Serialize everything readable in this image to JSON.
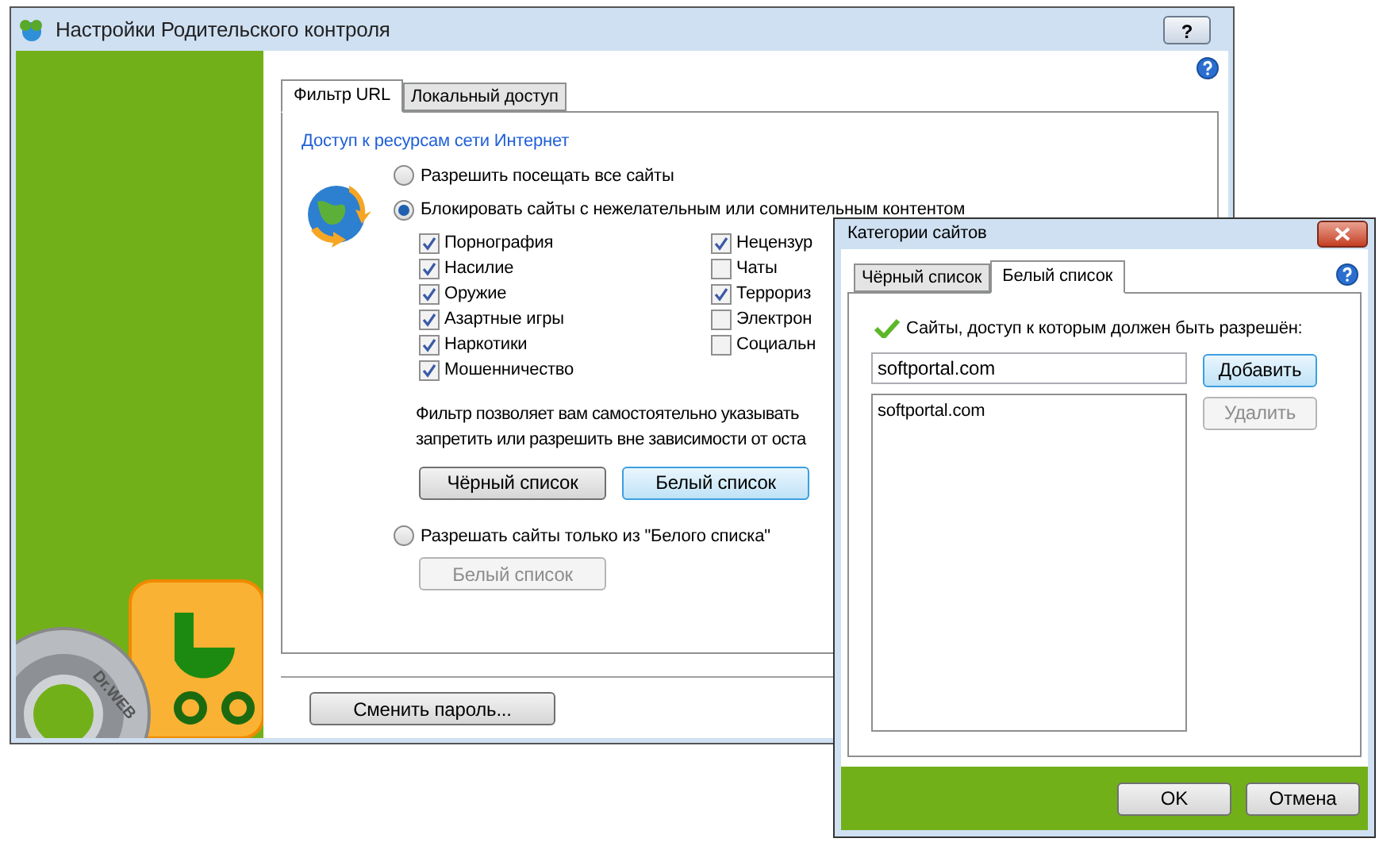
{
  "main_window": {
    "title": "Настройки Родительского контроля",
    "title_help_button": "?",
    "brand": "Dr.WEB",
    "tabs": [
      {
        "label": "Фильтр URL",
        "selected": true
      },
      {
        "label": "Локальный доступ",
        "selected": false
      }
    ],
    "section_title": "Доступ к ресурсам сети Интернет",
    "allow_all": {
      "label": "Разрешить посещать все сайты",
      "selected": false
    },
    "block": {
      "label": "Блокировать сайты с нежелательным или сомнительным контентом",
      "selected": true,
      "categories_left": [
        {
          "label": "Порнография",
          "checked": true
        },
        {
          "label": "Насилие",
          "checked": true
        },
        {
          "label": "Оружие",
          "checked": true
        },
        {
          "label": "Азартные игры",
          "checked": true
        },
        {
          "label": "Наркотики",
          "checked": true
        },
        {
          "label": "Мошенничество",
          "checked": true
        }
      ],
      "categories_right": [
        {
          "label": "Нецензур",
          "checked": true
        },
        {
          "label": "Чаты",
          "checked": false
        },
        {
          "label": "Террориз",
          "checked": true
        },
        {
          "label": "Электрон",
          "checked": false
        },
        {
          "label": "Социальн",
          "checked": false
        }
      ],
      "note_lines": [
        "Фильтр позволяет вам самостоятельно указывать",
        "запретить или разрешить вне зависимости от оста"
      ],
      "buttons": [
        {
          "label": "Чёрный список",
          "focused": false
        },
        {
          "label": "Белый список",
          "focused": true
        }
      ]
    },
    "whitelist_only": {
      "label": "Разрешать сайты только из \"Белого списка\"",
      "selected": false,
      "button": {
        "label": "Белый список",
        "disabled": true
      }
    },
    "change_password_button": "Сменить пароль..."
  },
  "dialog": {
    "title": "Категории сайтов",
    "tabs": [
      {
        "label": "Чёрный список",
        "selected": false
      },
      {
        "label": "Белый список",
        "selected": true
      }
    ],
    "label": "Сайты, доступ к которым должен быть разрешён:",
    "input_value": "softportal.com",
    "buttons": [
      {
        "label": "Добавить",
        "disabled": false,
        "focused": true
      },
      {
        "label": "Удалить",
        "disabled": true,
        "focused": false
      }
    ],
    "list_items": [
      "softportal.com"
    ],
    "footer_buttons": [
      "OK",
      "Отмена"
    ]
  }
}
